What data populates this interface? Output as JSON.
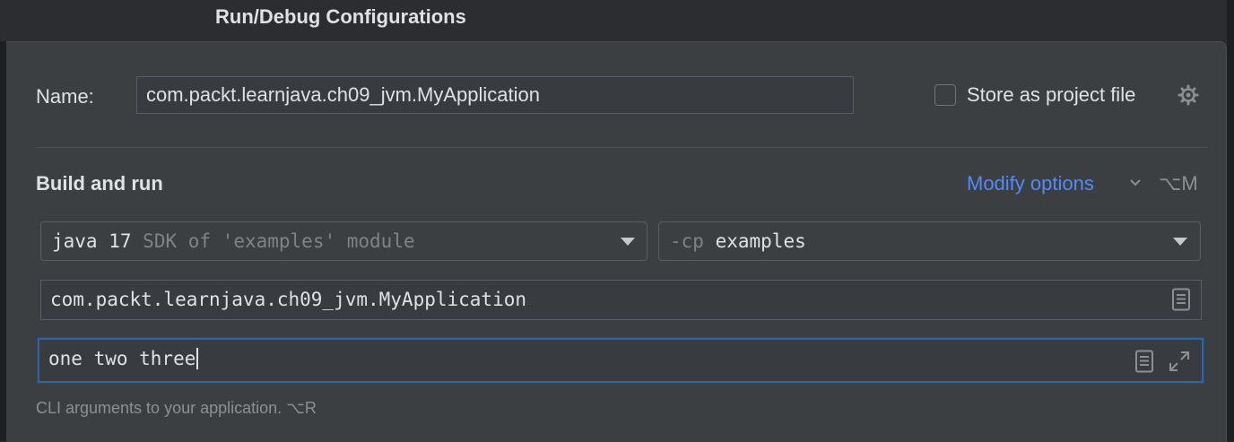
{
  "window": {
    "title": "Run/Debug Configurations"
  },
  "name_row": {
    "label": "Name:",
    "value": "com.packt.learnjava.ch09_jvm.MyApplication",
    "store_label": "Store as project file",
    "store_checked": false
  },
  "build_run": {
    "title": "Build and run",
    "modify_options": "Modify options",
    "modify_shortcut": "⌥M",
    "jre_select": {
      "value": "java 17",
      "hint": "SDK of 'examples' module"
    },
    "classpath_select": {
      "prefix": "-cp",
      "value": "examples"
    },
    "main_class": "com.packt.learnjava.ch09_jvm.MyApplication",
    "program_args": "one two three",
    "hint": "CLI arguments to your application. ⌥R"
  },
  "colors": {
    "background": "#3c3f41",
    "accent": "#548af7",
    "focus_border": "#35639b"
  }
}
